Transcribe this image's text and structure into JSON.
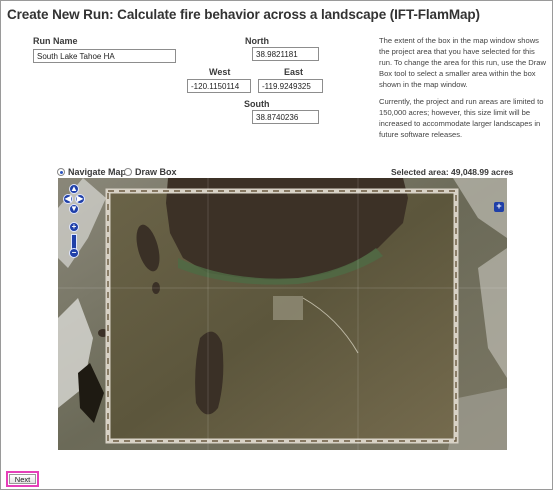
{
  "page": {
    "title": "Create New Run: Calculate fire behavior across a landscape (IFT-FlamMap)"
  },
  "form": {
    "run_name_label": "Run Name",
    "run_name_value": "South Lake Tahoe HA",
    "north_label": "North",
    "north_value": "38.9821181",
    "west_label": "West",
    "west_value": "-120.1150114",
    "east_label": "East",
    "east_value": "-119.9249325",
    "south_label": "South",
    "south_value": "38.8740236"
  },
  "help": {
    "paragraph1": "The extent of the box in the map window shows the project area that you have selected for this run. To change the area for this run, use the Draw Box tool to select a smaller area within the box shown in the map window.",
    "paragraph2": "Currently, the project and run areas are limited to 150,000 acres; however, this size limit will be increased to accommodate larger landscapes in future software releases."
  },
  "map_tools": {
    "navigate_label": "Navigate Map",
    "draw_box_label": "Draw Box",
    "selected": "Navigate Map",
    "selected_area": "Selected area: 49,048.99 acres"
  },
  "map": {
    "pan_icons": [
      "pan-up-icon",
      "pan-left-icon",
      "pan-right-icon",
      "pan-down-icon"
    ],
    "zoom_in_icon": "zoom-in-icon",
    "zoom_out_icon": "zoom-out-icon",
    "expand_icon": "layer-switcher-icon",
    "selection_color": "#d8d2c6"
  },
  "footer": {
    "next_label": "Next",
    "highlight_color": "#e63fb9"
  }
}
